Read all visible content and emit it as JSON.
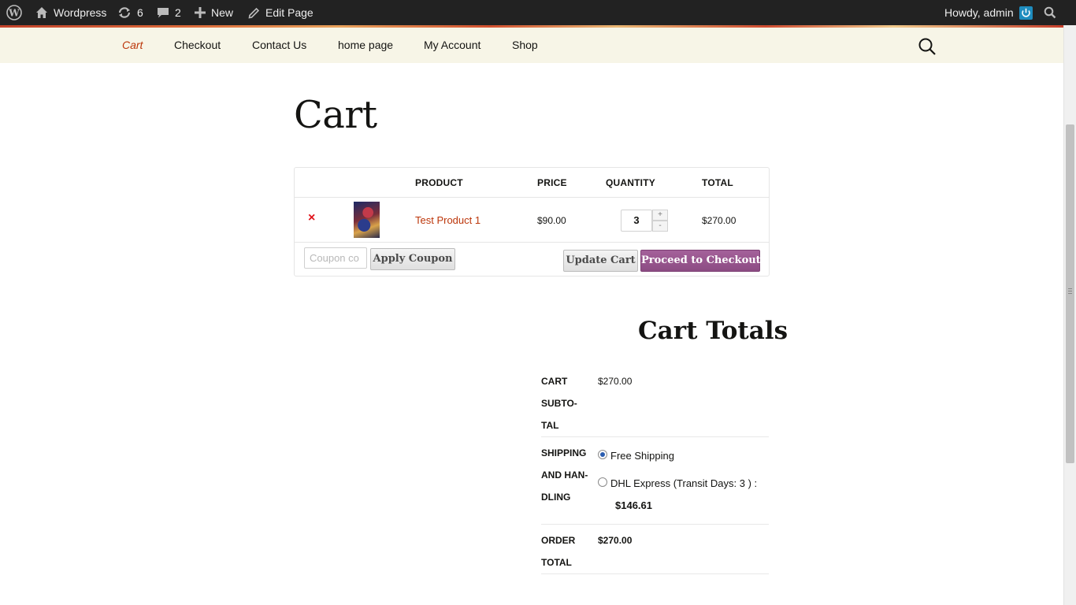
{
  "admin_bar": {
    "site_name": "Wordpress",
    "updates_count": "6",
    "comments_count": "2",
    "new_label": "New",
    "edit_label": "Edit Page",
    "greeting": "Howdy, admin"
  },
  "nav": {
    "items": [
      {
        "label": "Cart",
        "active": true
      },
      {
        "label": "Checkout"
      },
      {
        "label": "Contact Us"
      },
      {
        "label": "home page"
      },
      {
        "label": "My Account"
      },
      {
        "label": "Shop"
      }
    ]
  },
  "page": {
    "title": "Cart"
  },
  "cart": {
    "headers": [
      "PRODUCT",
      "PRICE",
      "QUANTITY",
      "TOTAL"
    ],
    "remove_symbol": "×",
    "item": {
      "name": "Test Product 1",
      "price": "$90.00",
      "quantity": "3",
      "total": "$270.00"
    },
    "qty_plus": "+",
    "qty_minus": "-",
    "coupon_placeholder": "Coupon co",
    "apply_coupon_label": "Apply Coupon",
    "update_cart_label": "Update Cart",
    "checkout_label": "Proceed to Checkout"
  },
  "totals": {
    "title": "Cart Totals",
    "subtotal_label": "CART SUBTO-TAL",
    "subtotal_lines": [
      "CART",
      "SUBTO-",
      "TAL"
    ],
    "subtotal_value": "$270.00",
    "shipping_lines": [
      "SHIPPING",
      "AND HAN-",
      "DLING"
    ],
    "shipping_options": [
      {
        "label": "Free Shipping",
        "selected": true
      },
      {
        "label": "DHL Express (Transit Days: 3 ) :",
        "price": "$146.61",
        "selected": false
      }
    ],
    "order_total_lines": [
      "ORDER",
      "TOTAL"
    ],
    "order_total_value": "$270.00"
  },
  "colors": {
    "admin_bar_bg": "#222222",
    "nav_bg": "#f7f5e7",
    "accent_link": "#bc360a",
    "remove_red": "#e0131b",
    "checkout_purple": "#a4619a"
  }
}
